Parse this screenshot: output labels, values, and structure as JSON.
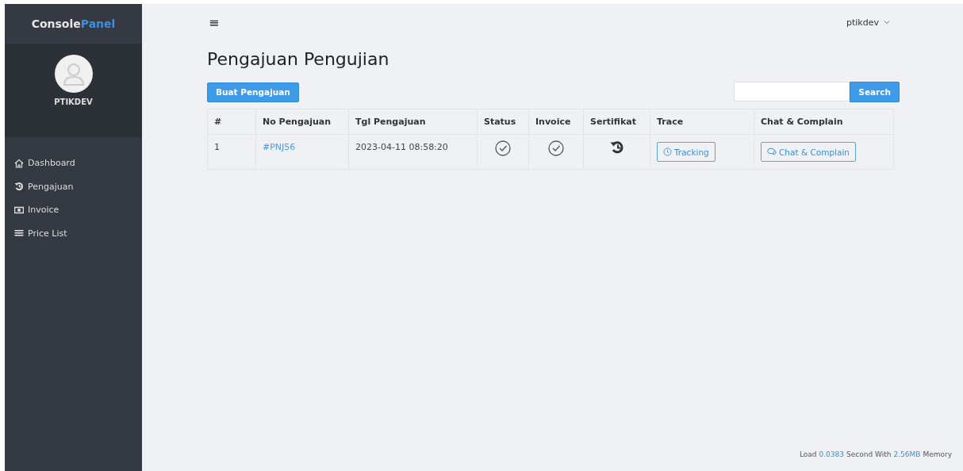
{
  "sidebar": {
    "brand": [
      {
        "text": "Console",
        "accent": false
      },
      {
        "text": "Panel",
        "accent": true
      }
    ],
    "user": "PTIKDEV",
    "items": [
      {
        "label": "Dashboard",
        "kind": "home"
      },
      {
        "label": "Pengajuan",
        "kind": "history"
      },
      {
        "label": "Invoice",
        "kind": "money"
      },
      {
        "label": "Price List",
        "kind": "list"
      }
    ]
  },
  "topbar": {
    "menu_icon": "≡",
    "user": "ptikdev"
  },
  "page": {
    "title": "Pengajuan Pengujian",
    "create_button": "Buat Pengajuan",
    "search_button": "Search"
  },
  "table": {
    "columns": [
      "#",
      "No Pengajuan",
      "Tgl Pengajuan",
      "Status",
      "Invoice",
      "Sertifikat",
      "Trace",
      "Chat & Complain"
    ],
    "rows": [
      {
        "no": "1",
        "code": "#PNJ56",
        "date": "2023-04-11 08:58:20",
        "icons": [
          {
            "kind": "check"
          },
          {
            "kind": "check"
          },
          {
            "kind": "history"
          }
        ],
        "trace": "Tracking",
        "chat": "Chat & Complain"
      }
    ]
  },
  "footer": [
    {
      "text": "Load",
      "highlight": false
    },
    {
      "text": "0.0383",
      "highlight": true
    },
    {
      "text": "Second With",
      "highlight": false
    },
    {
      "text": "2.56MB",
      "highlight": true
    },
    {
      "text": "Memory",
      "highlight": false
    }
  ]
}
